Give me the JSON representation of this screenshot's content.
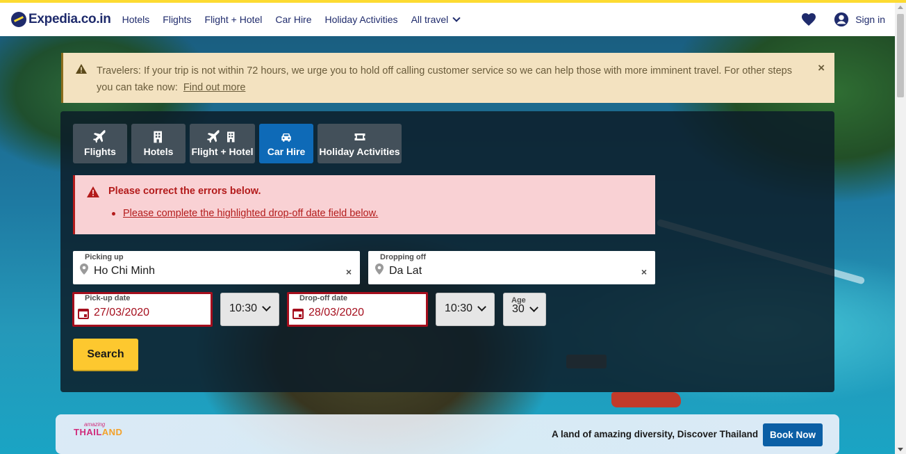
{
  "colors": {
    "brand_navy": "#1f2b6c",
    "brand_yellow": "#fddb32",
    "active_tab": "#0e6ab7",
    "error_red": "#b31b1b",
    "search_button": "#fdc82f"
  },
  "header": {
    "logo_text": "Expedia.co.in",
    "nav": [
      "Hotels",
      "Flights",
      "Flight + Hotel",
      "Car Hire",
      "Holiday Activities"
    ],
    "all_travel": "All travel",
    "sign_in": "Sign in",
    "icons": [
      "heart-icon",
      "account-icon"
    ]
  },
  "alert": {
    "text": "Travelers: If your trip is not within 72 hours, we urge you to hold off calling customer service so we can help those with more imminent travel. For other steps you can take now:",
    "link": "Find out more",
    "close": "×"
  },
  "search_tabs": [
    {
      "label": "Flights",
      "icon": "plane-icon",
      "active": false
    },
    {
      "label": "Hotels",
      "icon": "building-icon",
      "active": false
    },
    {
      "label": "Flight + Hotel",
      "icon": "plane-building-icon",
      "active": false
    },
    {
      "label": "Car Hire",
      "icon": "car-icon",
      "active": true
    },
    {
      "label": "Holiday Activities",
      "icon": "ticket-icon",
      "active": false
    }
  ],
  "errors": {
    "title": "Please correct the errors below.",
    "items": [
      "Please complete the highlighted drop-off date field below."
    ]
  },
  "form": {
    "pickup": {
      "label": "Picking up",
      "value": "Ho Chi Minh",
      "clear": "×"
    },
    "dropoff": {
      "label": "Dropping off",
      "value": "Da Lat",
      "clear": "×"
    },
    "pickup_date": {
      "label": "Pick-up date",
      "value": "27/03/2020"
    },
    "pickup_time": {
      "value": "10:30"
    },
    "dropoff_date": {
      "label": "Drop-off date",
      "value": "28/03/2020"
    },
    "dropoff_time": {
      "value": "10:30"
    },
    "age": {
      "label": "Age",
      "value": "30"
    },
    "search_label": "Search"
  },
  "promo": {
    "logo_small": "amazing",
    "logo_main_a": "THAIL",
    "logo_main_b": "AND",
    "text": "A land of amazing diversity, Discover Thailand",
    "button": "Book Now"
  }
}
